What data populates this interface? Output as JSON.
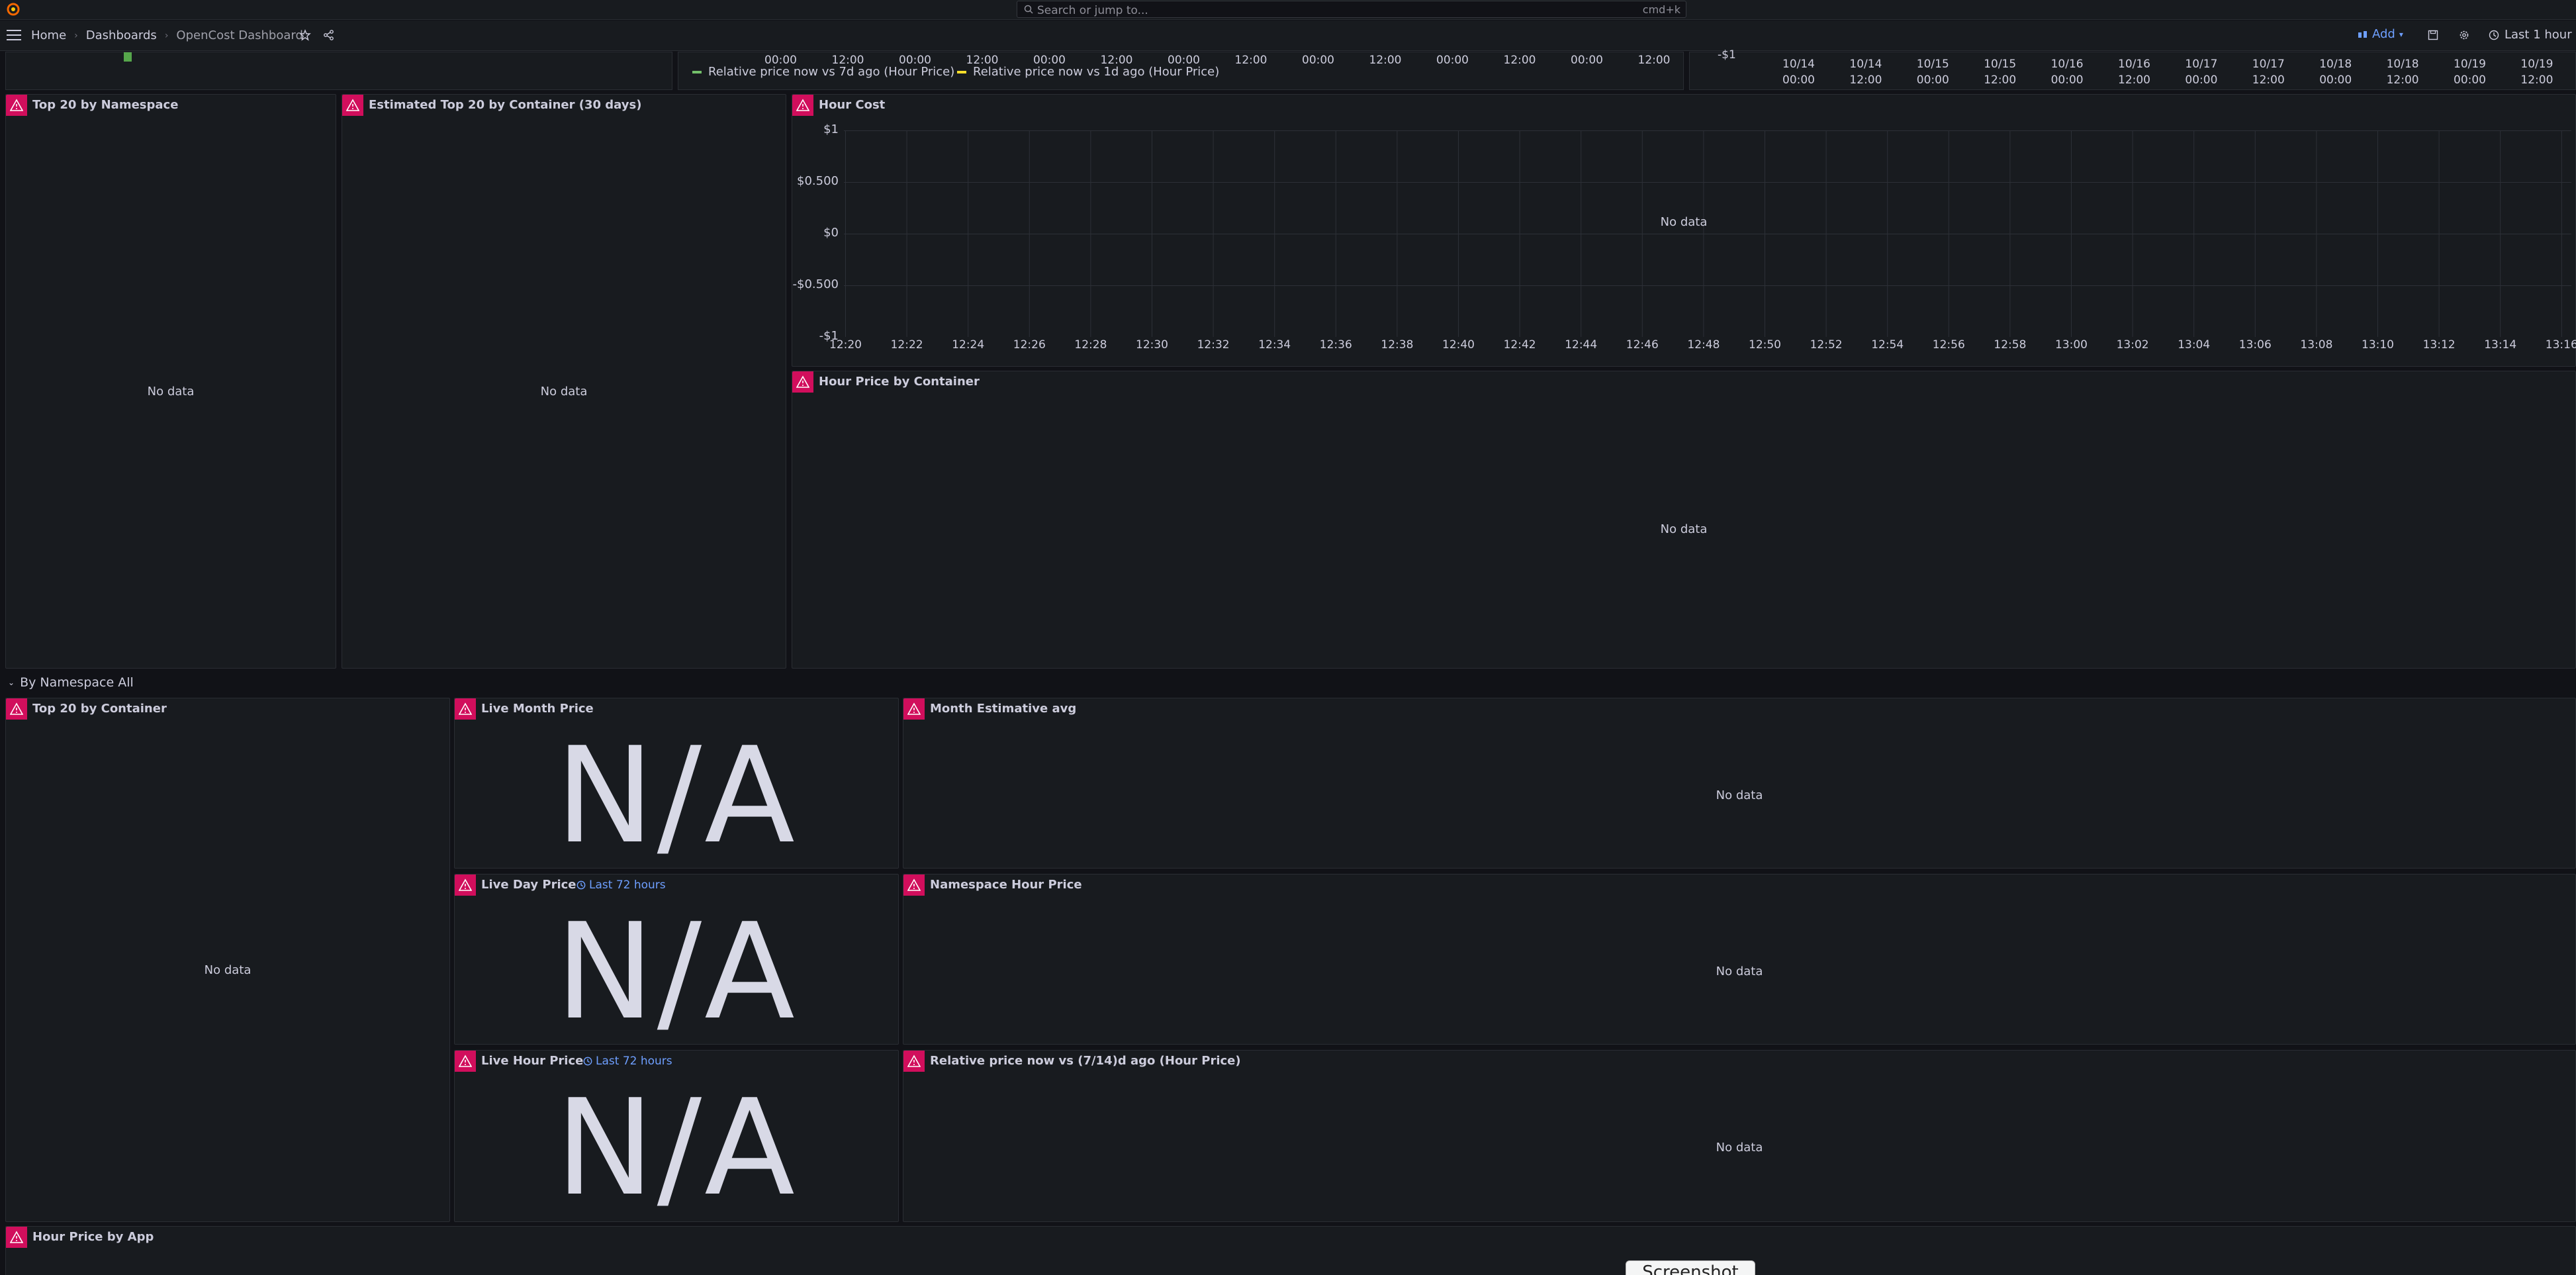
{
  "search": {
    "placeholder": "Search or jump to...",
    "shortcut": "cmd+k"
  },
  "breadcrumb": {
    "home": "Home",
    "dashboards": "Dashboards",
    "current": "OpenCost Dashboard"
  },
  "nav": {
    "add_label": "Add",
    "time_range": "Last 1 hour"
  },
  "top_strip": {
    "mid_times": [
      "00:00",
      "12:00",
      "00:00",
      "12:00",
      "00:00",
      "12:00",
      "00:00",
      "12:00",
      "00:00",
      "12:00",
      "00:00",
      "12:00",
      "00:00",
      "12:00"
    ],
    "legend": [
      {
        "label": "Relative price now vs 7d ago (Hour Price)",
        "color": "#73bf69"
      },
      {
        "label": "Relative price now vs 1d ago (Hour Price)",
        "color": "#fade2a"
      }
    ],
    "right_label": "-$1",
    "right_dates": [
      "10/14",
      "10/14",
      "10/15",
      "10/15",
      "10/16",
      "10/16",
      "10/17",
      "10/17",
      "10/18",
      "10/18",
      "10/19",
      "10/19"
    ],
    "right_times": [
      "00:00",
      "12:00",
      "00:00",
      "12:00",
      "00:00",
      "12:00",
      "00:00",
      "12:00",
      "00:00",
      "12:00",
      "00:00",
      "12:00"
    ]
  },
  "panels": {
    "top20_namespace": {
      "title": "Top 20 by Namespace",
      "empty": "No data"
    },
    "est_top20_container": {
      "title": "Estimated Top 20 by Container (30 days)",
      "empty": "No data"
    },
    "hour_cost": {
      "title": "Hour Cost",
      "empty": "No data",
      "y_ticks": [
        "$1",
        "$0.500",
        "$0",
        "-$0.500",
        "-$1"
      ],
      "x_ticks": [
        "12:20",
        "12:22",
        "12:24",
        "12:26",
        "12:28",
        "12:30",
        "12:32",
        "12:34",
        "12:36",
        "12:38",
        "12:40",
        "12:42",
        "12:44",
        "12:46",
        "12:48",
        "12:50",
        "12:52",
        "12:54",
        "12:56",
        "12:58",
        "13:00",
        "13:02",
        "13:04",
        "13:06",
        "13:08",
        "13:10",
        "13:12",
        "13:14",
        "13:16"
      ]
    },
    "hour_price_container": {
      "title": "Hour Price by Container",
      "empty": "No data"
    },
    "top20_container": {
      "title": "Top 20 by Container",
      "empty": "No data"
    },
    "live_month": {
      "title": "Live Month Price",
      "value": "N/A"
    },
    "month_est": {
      "title": "Month Estimative avg",
      "empty": "No data"
    },
    "live_day": {
      "title": "Live Day Price",
      "range": "Last 72 hours",
      "value": "N/A"
    },
    "ns_hour": {
      "title": "Namespace Hour Price",
      "empty": "No data"
    },
    "live_hour": {
      "title": "Live Hour Price",
      "range": "Last 72 hours",
      "value": "N/A"
    },
    "relative": {
      "title": "Relative price now vs (7/14)d ago (Hour Price)",
      "empty": "No data"
    },
    "hour_app": {
      "title": "Hour Price by App"
    }
  },
  "row": {
    "title": "By Namespace All"
  },
  "overlay": {
    "screenshot_label": "Screenshot"
  },
  "colors": {
    "accent": "#6e9fff",
    "error": "#d10e5c",
    "background": "#111217",
    "panel": "#181b1f"
  }
}
